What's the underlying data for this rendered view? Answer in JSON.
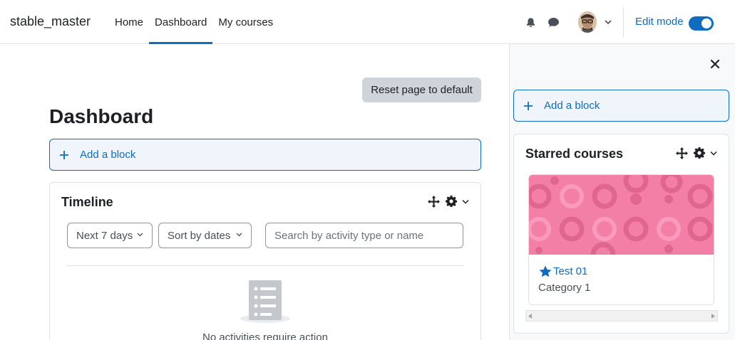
{
  "navbar": {
    "brand": "stable_master",
    "items": [
      {
        "label": "Home",
        "active": false
      },
      {
        "label": "Dashboard",
        "active": true
      },
      {
        "label": "My courses",
        "active": false
      }
    ],
    "edit_mode_label": "Edit mode",
    "edit_mode_on": true
  },
  "main": {
    "reset_label": "Reset page to default",
    "title": "Dashboard",
    "add_block_label": "Add a block",
    "timeline": {
      "title": "Timeline",
      "filter_label": "Next 7 days",
      "sort_label": "Sort by dates",
      "search_placeholder": "Search by activity type or name",
      "empty_message": "No activities require action"
    }
  },
  "drawer": {
    "add_block_label": "Add a block",
    "starred": {
      "title": "Starred courses",
      "course_name": "Test 01",
      "course_category": "Category 1"
    }
  },
  "colors": {
    "primary": "#0f6cbf",
    "course_image": "#f47fa6"
  }
}
